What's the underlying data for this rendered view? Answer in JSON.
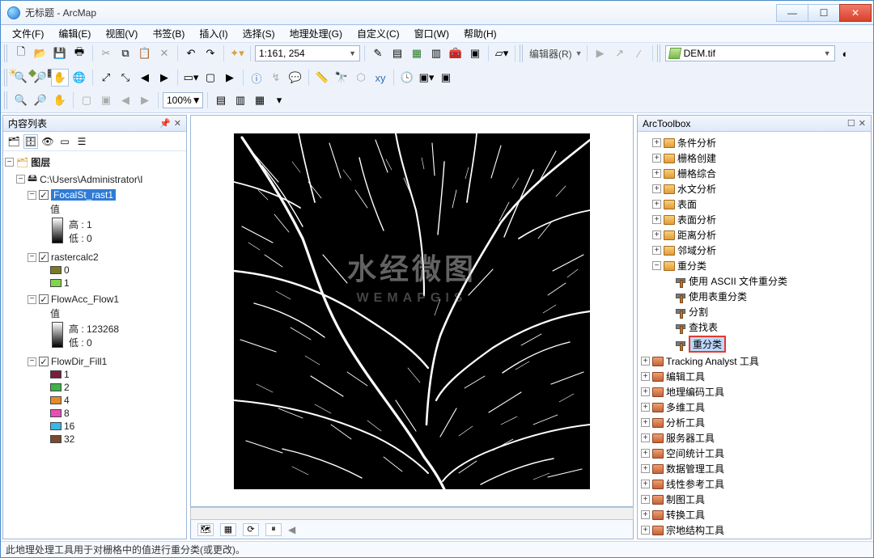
{
  "window": {
    "title": "无标题 - ArcMap"
  },
  "menu": [
    "文件(F)",
    "编辑(E)",
    "视图(V)",
    "书签(B)",
    "插入(I)",
    "选择(S)",
    "地理处理(G)",
    "自定义(C)",
    "窗口(W)",
    "帮助(H)"
  ],
  "toolbar": {
    "scale": "1:161, 254",
    "editor_label": "编辑器(R)",
    "combo_value": "DEM.tif",
    "zoom_pct": "100%"
  },
  "toc": {
    "title": "内容列表",
    "root": "图层",
    "path": "C:\\Users\\Administrator\\I",
    "layers": [
      {
        "name": "FocalSt_rast1",
        "checked": true,
        "selected": true,
        "renderer": "stretched",
        "value_label": "值",
        "high_label": "高 : 1",
        "low_label": "低 : 0"
      },
      {
        "name": "rastercalc2",
        "checked": true,
        "renderer": "unique",
        "classes": [
          {
            "color": "#7a7a26",
            "label": "0"
          },
          {
            "color": "#7fd64b",
            "label": "1"
          }
        ]
      },
      {
        "name": "FlowAcc_Flow1",
        "checked": true,
        "renderer": "stretched",
        "value_label": "值",
        "high_label": "高 : 123268",
        "low_label": "低 : 0"
      },
      {
        "name": "FlowDir_Fill1",
        "checked": true,
        "renderer": "unique",
        "classes": [
          {
            "color": "#7a1d3a",
            "label": "1"
          },
          {
            "color": "#3fb24a",
            "label": "2"
          },
          {
            "color": "#e58a2a",
            "label": "4"
          },
          {
            "color": "#e64fb8",
            "label": "8"
          },
          {
            "color": "#3ab7e6",
            "label": "16"
          },
          {
            "color": "#7a4a2e",
            "label": "32"
          }
        ]
      }
    ]
  },
  "watermark": {
    "main": "水经微图",
    "sub": "WEMAPGIS"
  },
  "arctoolbox": {
    "title": "ArcToolbox",
    "group1": [
      "条件分析",
      "栅格创建",
      "栅格综合",
      "水文分析",
      "表面",
      "表面分析",
      "距离分析",
      "邻域分析"
    ],
    "reclass_group": "重分类",
    "reclass_tools": [
      "使用 ASCII 文件重分类",
      "使用表重分类",
      "分割",
      "查找表"
    ],
    "highlighted_tool": "重分类",
    "group2": [
      "Tracking Analyst 工具",
      "编辑工具",
      "地理编码工具",
      "多维工具",
      "分析工具",
      "服务器工具",
      "空间统计工具",
      "数据管理工具",
      "线性参考工具",
      "制图工具",
      "转换工具",
      "宗地结构工具"
    ]
  },
  "status": "此地理处理工具用于对栅格中的值进行重分类(或更改)。"
}
